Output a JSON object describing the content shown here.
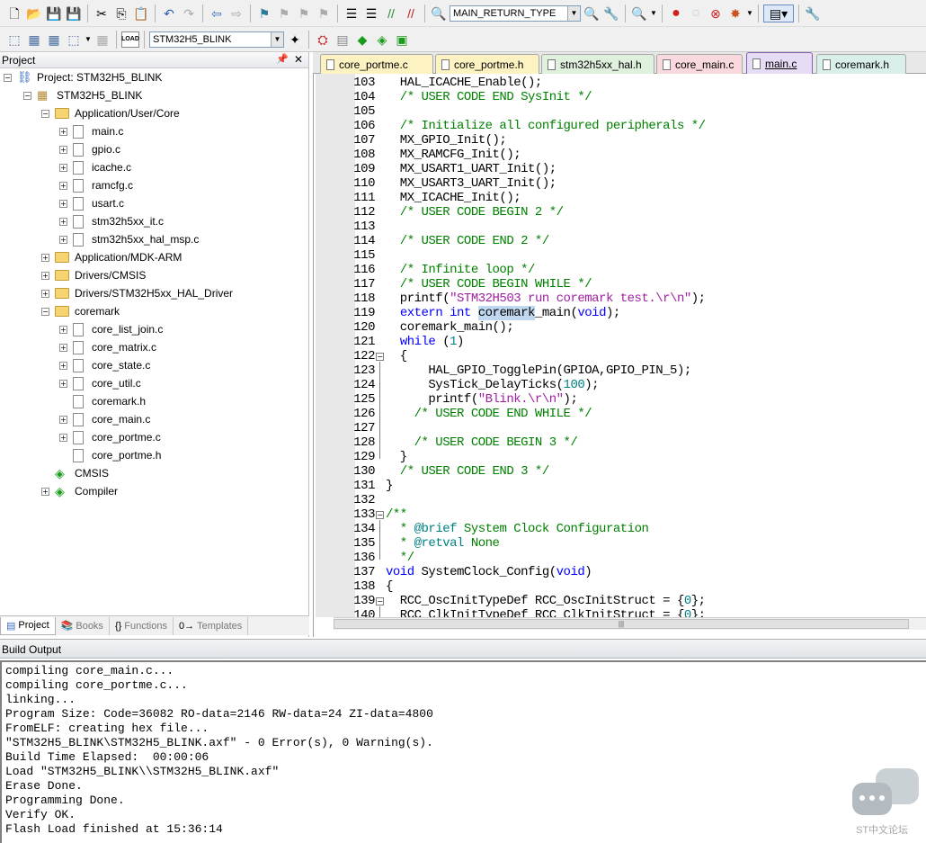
{
  "toolbar1": {
    "target_combo": "MAIN_RETURN_TYPE"
  },
  "toolbar2": {
    "target_select": "STM32H5_BLINK",
    "load_label": "LOAD"
  },
  "project": {
    "title": "Project",
    "root": "Project: STM32H5_BLINK",
    "target": "STM32H5_BLINK",
    "groups": [
      {
        "label": "Application/User/Core",
        "files": [
          "main.c",
          "gpio.c",
          "icache.c",
          "ramcfg.c",
          "usart.c",
          "stm32h5xx_it.c",
          "stm32h5xx_hal_msp.c"
        ]
      },
      {
        "label": "Application/MDK-ARM"
      },
      {
        "label": "Drivers/CMSIS"
      },
      {
        "label": "Drivers/STM32H5xx_HAL_Driver"
      },
      {
        "label": "coremark",
        "files": [
          "core_list_join.c",
          "core_matrix.c",
          "core_state.c",
          "core_util.c",
          "coremark.h",
          "core_main.c",
          "core_portme.c",
          "core_portme.h"
        ]
      }
    ],
    "extras": [
      "CMSIS",
      "Compiler"
    ],
    "tabs": [
      "Project",
      "Books",
      "Functions",
      "Templates"
    ]
  },
  "editor": {
    "tabs": [
      "core_portme.c",
      "core_portme.h",
      "stm32h5xx_hal.h",
      "core_main.c",
      "main.c",
      "coremark.h"
    ],
    "active_tab": "main.c",
    "line_numbers": [
      "103",
      "104",
      "105",
      "106",
      "107",
      "108",
      "109",
      "110",
      "111",
      "112",
      "113",
      "114",
      "115",
      "116",
      "117",
      "118",
      "119",
      "120",
      "121",
      "122",
      "123",
      "124",
      "125",
      "126",
      "127",
      "128",
      "129",
      "130",
      "131",
      "132",
      "133",
      "134",
      "135",
      "136",
      "137",
      "138",
      "139",
      "140"
    ],
    "tokens": {
      "l103": "  HAL_ICACHE_Enable();",
      "l104": "  /* USER CODE END SysInit */",
      "l106": "  /* Initialize all configured peripherals */",
      "l107": "  MX_GPIO_Init();",
      "l108": "  MX_RAMCFG_Init();",
      "l109": "  MX_USART1_UART_Init();",
      "l110": "  MX_USART3_UART_Init();",
      "l111": "  MX_ICACHE_Init();",
      "l112": "  /* USER CODE BEGIN 2 */",
      "l114": "  /* USER CODE END 2 */",
      "l116": "  /* Infinite loop */",
      "l117": "  /* USER CODE BEGIN WHILE */",
      "l118a": "  printf(",
      "l118b": "\"STM32H503 run coremark test.\\r\\n\"",
      "l118c": ");",
      "l119a": "  ",
      "l119b": "extern int",
      "l119c": " ",
      "l119d": "coremark",
      "l119e": "_main(",
      "l119f": "void",
      "l119g": ");",
      "l120": "  coremark_main();",
      "l121a": "  ",
      "l121b": "while",
      "l121c": " (",
      "l121d": "1",
      "l121e": ")",
      "l122": "  {",
      "l123": "      HAL_GPIO_TogglePin(GPIOA,GPIO_PIN_5);",
      "l124a": "      SysTick_DelayTicks(",
      "l124b": "100",
      "l124c": ");",
      "l125a": "      printf(",
      "l125b": "\"Blink.\\r\\n\"",
      "l125c": ");",
      "l126": "    /* USER CODE END WHILE */",
      "l128": "    /* USER CODE BEGIN 3 */",
      "l129": "  }",
      "l130": "  /* USER CODE END 3 */",
      "l131": "}",
      "l133": "/**",
      "l134a": "  * ",
      "l134b": "@brief",
      "l134c": " System Clock Configuration",
      "l135a": "  * ",
      "l135b": "@retval",
      "l135c": " None",
      "l136": "  */",
      "l137a": "void",
      "l137b": " SystemClock_Config(",
      "l137c": "void",
      "l137d": ")",
      "l138": "{",
      "l139a": "  RCC_OscInitTypeDef RCC_OscInitStruct = {",
      "l139b": "0",
      "l139c": "};",
      "l140a": "  RCC_ClkInitTypeDef RCC_ClkInitStruct = {",
      "l140b": "0",
      "l140c": "};"
    }
  },
  "build_output": {
    "title": "Build Output",
    "lines": [
      "compiling core_main.c...",
      "compiling core_portme.c...",
      "linking...",
      "Program Size: Code=36082 RO-data=2146 RW-data=24 ZI-data=4800",
      "FromELF: creating hex file...",
      "\"STM32H5_BLINK\\STM32H5_BLINK.axf\" - 0 Error(s), 0 Warning(s).",
      "Build Time Elapsed:  00:00:06",
      "Load \"STM32H5_BLINK\\\\STM32H5_BLINK.axf\"",
      "Erase Done.",
      "Programming Done.",
      "Verify OK.",
      "Flash Load finished at 15:36:14"
    ]
  },
  "watermark": "ST中文论坛"
}
